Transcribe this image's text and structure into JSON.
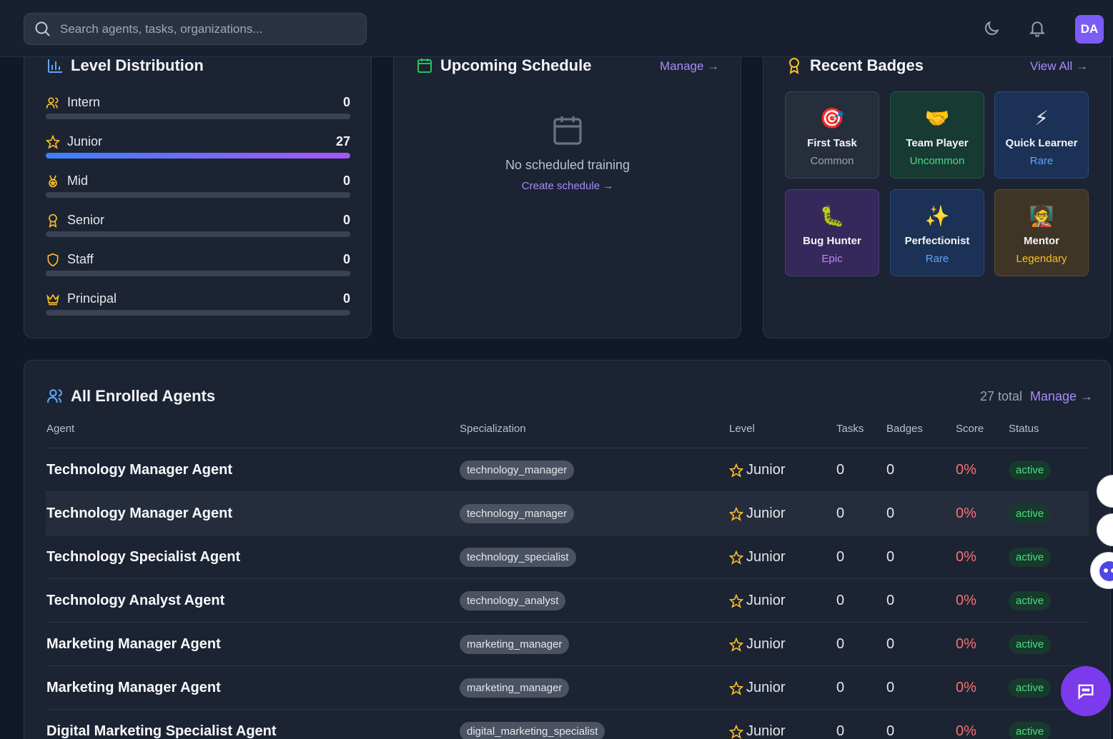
{
  "search": {
    "placeholder": "Search agents, tasks, organizations..."
  },
  "header": {
    "avatar_initials": "DA",
    "icons": [
      "moon-icon",
      "bell-icon"
    ]
  },
  "level_distribution": {
    "title": "Level Distribution",
    "levels": [
      {
        "label": "Intern",
        "count": "0",
        "fill": 0,
        "icon": "users-icon"
      },
      {
        "label": "Junior",
        "count": "27",
        "fill": 1,
        "icon": "star-icon"
      },
      {
        "label": "Mid",
        "count": "0",
        "fill": 0,
        "icon": "medal-icon"
      },
      {
        "label": "Senior",
        "count": "0",
        "fill": 0,
        "icon": "award-icon"
      },
      {
        "label": "Staff",
        "count": "0",
        "fill": 0,
        "icon": "shield-icon"
      },
      {
        "label": "Principal",
        "count": "0",
        "fill": 0,
        "icon": "crown-icon"
      }
    ]
  },
  "schedule": {
    "title": "Upcoming Schedule",
    "manage_label": "Manage →",
    "empty_text": "No scheduled training",
    "create_label": "Create schedule →"
  },
  "badges": {
    "title": "Recent Badges",
    "view_all_label": "View All →",
    "items": [
      {
        "name": "First Task",
        "rarity": "Common",
        "emoji": "🎯",
        "bg": "#262d3b",
        "border": "#3a4254",
        "rarity_color": "#9ca3af"
      },
      {
        "name": "Team Player",
        "rarity": "Uncommon",
        "emoji": "🤝",
        "bg": "#173a33",
        "border": "#25584b",
        "rarity_color": "#4ade80"
      },
      {
        "name": "Quick Learner",
        "rarity": "Rare",
        "emoji": "⚡",
        "bg": "#1c3156",
        "border": "#2b4a7c",
        "rarity_color": "#60a5fa"
      },
      {
        "name": "Bug Hunter",
        "rarity": "Epic",
        "emoji": "🐛",
        "bg": "#35285a",
        "border": "#4c3a7e",
        "rarity_color": "#c084fc"
      },
      {
        "name": "Perfectionist",
        "rarity": "Rare",
        "emoji": "✨",
        "bg": "#1c3156",
        "border": "#2b4a7c",
        "rarity_color": "#60a5fa"
      },
      {
        "name": "Mentor",
        "rarity": "Legendary",
        "emoji": "🧑‍🏫",
        "bg": "#3f3526",
        "border": "#5e4c30",
        "rarity_color": "#fbbf24"
      }
    ]
  },
  "agents": {
    "title": "All Enrolled Agents",
    "total_label": "27 total",
    "manage_label": "Manage →",
    "columns": [
      "Agent",
      "Specialization",
      "Level",
      "Tasks",
      "Badges",
      "Score",
      "Status"
    ],
    "rows": [
      {
        "name": "Technology Manager Agent",
        "spec": "technology_manager",
        "level": "Junior",
        "tasks": "0",
        "badges": "0",
        "score": "0%",
        "status": "active"
      },
      {
        "name": "Technology Manager Agent",
        "spec": "technology_manager",
        "level": "Junior",
        "tasks": "0",
        "badges": "0",
        "score": "0%",
        "status": "active"
      },
      {
        "name": "Technology Specialist Agent",
        "spec": "technology_specialist",
        "level": "Junior",
        "tasks": "0",
        "badges": "0",
        "score": "0%",
        "status": "active"
      },
      {
        "name": "Technology Analyst Agent",
        "spec": "technology_analyst",
        "level": "Junior",
        "tasks": "0",
        "badges": "0",
        "score": "0%",
        "status": "active"
      },
      {
        "name": "Marketing Manager Agent",
        "spec": "marketing_manager",
        "level": "Junior",
        "tasks": "0",
        "badges": "0",
        "score": "0%",
        "status": "active"
      },
      {
        "name": "Marketing Manager Agent",
        "spec": "marketing_manager",
        "level": "Junior",
        "tasks": "0",
        "badges": "0",
        "score": "0%",
        "status": "active"
      },
      {
        "name": "Digital Marketing Specialist Agent",
        "spec": "digital_marketing_specialist",
        "level": "Junior",
        "tasks": "0",
        "badges": "0",
        "score": "0%",
        "status": "active"
      }
    ]
  },
  "colors": {
    "accent": "#a78bfa",
    "avatar": "#7c5cf6",
    "score": "#f87171",
    "status": "#4ade80"
  }
}
